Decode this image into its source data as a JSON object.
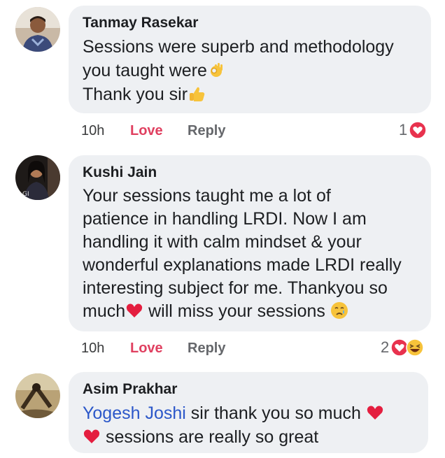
{
  "comments": [
    {
      "author": "Tanmay Rasekar",
      "lines": [
        "Sessions were superb and methodology",
        "you taught were",
        "Thank you sir"
      ],
      "time": "10h",
      "love_label": "Love",
      "reply_label": "Reply",
      "reaction_count": "1",
      "reactions": [
        "love-icon"
      ]
    },
    {
      "author": "Kushi Jain",
      "lines": [
        "Your sessions taught me a lot of",
        "patience in handling LRDI. Now I am",
        "handling it with  calm mindset & your",
        "wonderful explanations made LRDI really",
        "interesting subject for me. Thankyou so",
        "much",
        " will miss your sessions "
      ],
      "time": "10h",
      "love_label": "Love",
      "reply_label": "Reply",
      "reaction_count": "2",
      "reactions": [
        "love-icon",
        "haha-icon"
      ]
    },
    {
      "author": "Asim Prakhar",
      "mention": "Yogesh Joshi",
      "lines": [
        " sir thank you so much ",
        " sessions are really so great"
      ]
    }
  ],
  "colors": {
    "bubble": "#eef0f3",
    "love": "#e04060",
    "mention": "#2b57c9",
    "heart": "#e41e3f"
  }
}
